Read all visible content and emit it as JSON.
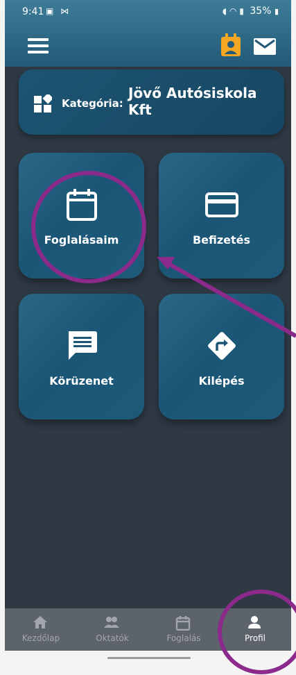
{
  "status_bar": {
    "time": "9:41",
    "battery": "35%"
  },
  "category": {
    "label": "Kategória:",
    "value": "Jövő Autósiskola Kft"
  },
  "tiles": [
    {
      "label": "Foglalásaim",
      "icon": "calendar-icon"
    },
    {
      "label": "Befizetés",
      "icon": "credit-card-icon"
    },
    {
      "label": "Körüzenet",
      "icon": "message-icon"
    },
    {
      "label": "Kilépés",
      "icon": "exit-direction-icon"
    }
  ],
  "bottom_nav": [
    {
      "label": "Kezdőlap",
      "icon": "home-icon",
      "active": false
    },
    {
      "label": "Oktatók",
      "icon": "people-icon",
      "active": false
    },
    {
      "label": "Foglalás",
      "icon": "calendar-icon",
      "active": false
    },
    {
      "label": "Profil",
      "icon": "person-icon",
      "active": true
    }
  ],
  "colors": {
    "accent_orange": "#f5a623",
    "header_blue": "#2c6884",
    "tile_blue": "#1c5676",
    "background": "#2e3944",
    "annotation_purple": "#8c2a8c"
  }
}
